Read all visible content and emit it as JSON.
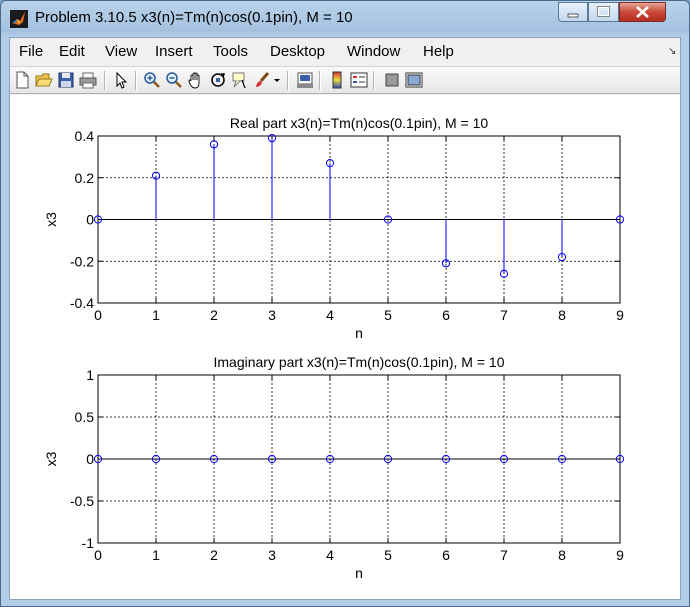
{
  "window": {
    "title": "Problem 3.10.5 x3(n)=Tm(n)cos(0.1pin), M = 10"
  },
  "menu": [
    "File",
    "Edit",
    "View",
    "Insert",
    "Tools",
    "Desktop",
    "Window",
    "Help"
  ],
  "toolbar_icons": [
    "new-file-icon",
    "open-folder-icon",
    "save-icon",
    "print-icon",
    "pointer-icon",
    "zoom-in-icon",
    "zoom-out-icon",
    "pan-hand-icon",
    "rotate-3d-icon",
    "data-cursor-icon",
    "brush-icon",
    "brush-dropdown-icon",
    "link-plot-icon",
    "colorbar-icon",
    "legend-icon",
    "hide-plot-tools-icon",
    "show-plot-tools-icon"
  ],
  "colors": {
    "stem": "#0000ff",
    "axes": "#000000",
    "grid": "#000000",
    "background": "#ffffff"
  },
  "chart_data": [
    {
      "type": "stem",
      "title": "Real part x3(n)=Tm(n)cos(0.1pin), M = 10",
      "xlabel": "n",
      "ylabel": "x3",
      "xlim": [
        0,
        9
      ],
      "ylim": [
        -0.4,
        0.4
      ],
      "xticks": [
        "0",
        "1",
        "2",
        "3",
        "4",
        "5",
        "6",
        "7",
        "8",
        "9"
      ],
      "yticks": [
        "0.4",
        "0.2",
        "0",
        "-0.2",
        "-0.4"
      ],
      "grid": true,
      "x": [
        0,
        1,
        2,
        3,
        4,
        5,
        6,
        7,
        8,
        9
      ],
      "values": [
        0,
        0.21,
        0.36,
        0.39,
        0.27,
        0,
        -0.21,
        -0.26,
        -0.18,
        0
      ]
    },
    {
      "type": "stem",
      "title": "Imaginary part x3(n)=Tm(n)cos(0.1pin), M = 10",
      "xlabel": "n",
      "ylabel": "x3",
      "xlim": [
        0,
        9
      ],
      "ylim": [
        -1,
        1
      ],
      "xticks": [
        "0",
        "1",
        "2",
        "3",
        "4",
        "5",
        "6",
        "7",
        "8",
        "9"
      ],
      "yticks": [
        "1",
        "0.5",
        "0",
        "-0.5",
        "-1"
      ],
      "grid": true,
      "x": [
        0,
        1,
        2,
        3,
        4,
        5,
        6,
        7,
        8,
        9
      ],
      "values": [
        0,
        0,
        0,
        0,
        0,
        0,
        0,
        0,
        0,
        0
      ]
    }
  ]
}
